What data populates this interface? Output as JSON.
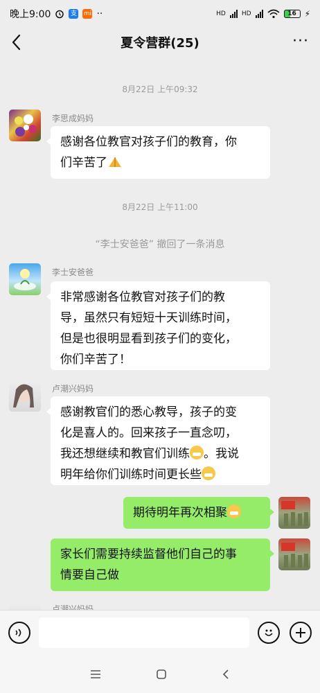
{
  "status_bar": {
    "time": "晚上9:00",
    "network1": "HD",
    "network2": "HD",
    "battery": "16"
  },
  "header": {
    "title": "夏令营群(25)",
    "back_icon": "chevron-left-icon",
    "more_icon": "more-dots-icon"
  },
  "messages": [
    {
      "kind": "time",
      "text": "8月22日 上午09:32"
    },
    {
      "kind": "left",
      "sender": "李思成妈妈",
      "lines": [
        "感谢各位教官对孩子们的教育，你",
        "们辛苦了"
      ]
    },
    {
      "kind": "time",
      "text": "8月22日 上午11:00"
    },
    {
      "kind": "system",
      "text": "“李士安爸爸” 撤回了一条消息"
    },
    {
      "kind": "left",
      "sender": "李士安爸爸",
      "lines": [
        "非常感谢各位教官对孩子们的教",
        "导，虽然只有短短十天训练时间，",
        "但是也很明显看到孩子们的变化，",
        "你们辛苦了！"
      ]
    },
    {
      "kind": "left",
      "sender": "卢潮兴妈妈",
      "lines": [
        "感谢教官们的悉心教导，孩子的变",
        "化是喜人的。回来孩子一直念叨，",
        "我还想继续和教官们训练",
        "。我说",
        "明年给你们训练时间更长些"
      ]
    },
    {
      "kind": "right",
      "lines": [
        "期待明年再次相聚"
      ]
    },
    {
      "kind": "right",
      "lines": [
        "家长们需要持续监督他们自己的事",
        "情要自己做"
      ]
    },
    {
      "kind": "left-partial",
      "sender": "卢潮兴妈妈"
    }
  ],
  "input_bar": {
    "voice_icon": "voice-icon",
    "emoji_icon": "emoji-icon",
    "add_icon": "plus-icon"
  },
  "nav_bar": {
    "menu_icon": "menu-icon",
    "home_icon": "home-icon",
    "back_icon": "back-icon"
  },
  "colors": {
    "background": "#ededed",
    "bubble_self": "#95ec69",
    "bubble_other": "#ffffff"
  }
}
